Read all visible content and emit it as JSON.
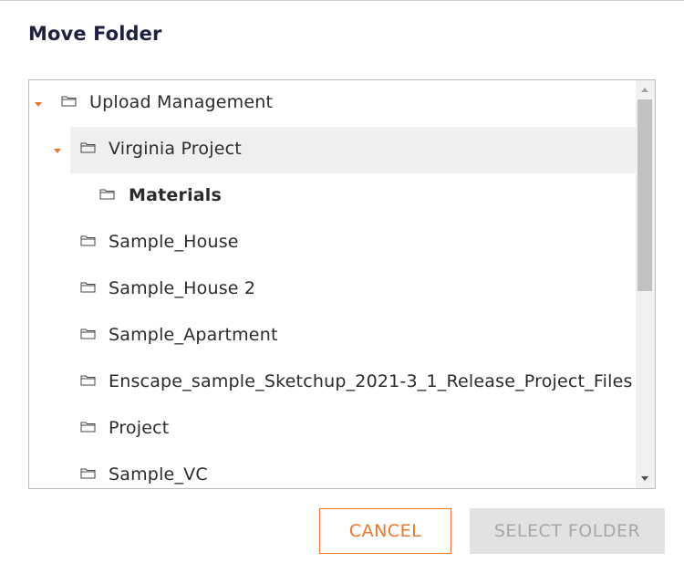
{
  "dialog": {
    "title": "Move Folder"
  },
  "tree": {
    "items": [
      {
        "label": "Upload Management",
        "expanded": true,
        "selected": false,
        "bold": false
      },
      {
        "label": "Virginia Project",
        "expanded": true,
        "selected": true,
        "bold": false
      },
      {
        "label": "Materials",
        "expanded": false,
        "selected": false,
        "bold": true
      },
      {
        "label": "Sample_House",
        "expanded": false,
        "selected": false,
        "bold": false
      },
      {
        "label": "Sample_House 2",
        "expanded": false,
        "selected": false,
        "bold": false
      },
      {
        "label": "Sample_Apartment",
        "expanded": false,
        "selected": false,
        "bold": false
      },
      {
        "label": "Enscape_sample_Sketchup_2021-3_1_Release_Project_Files",
        "expanded": false,
        "selected": false,
        "bold": false
      },
      {
        "label": "Project",
        "expanded": false,
        "selected": false,
        "bold": false
      },
      {
        "label": "Sample_VC",
        "expanded": false,
        "selected": false,
        "bold": false
      }
    ]
  },
  "buttons": {
    "cancel_label": "CANCEL",
    "select_label": "SELECT FOLDER"
  },
  "colors": {
    "accent": "#e8772e",
    "title": "#1f2140",
    "selected_row": "#efefef",
    "disabled_button": "#e2e2e2"
  }
}
